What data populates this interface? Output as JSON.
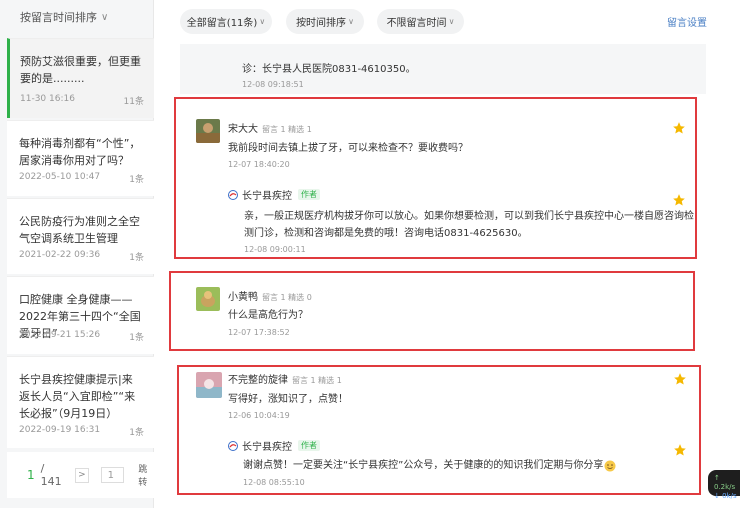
{
  "sidebar": {
    "sort_label": "按留言时间排序",
    "articles": [
      {
        "title": "预防艾滋很重要，但更重要的是.........",
        "date": "11-30 16:16",
        "count": "11条"
      },
      {
        "title": "每种消毒剂都有“个性”，居家消毒你用对了吗？",
        "date": "2022-05-10 10:47",
        "count": "1条"
      },
      {
        "title": "公民防疫行为准则之全空气空调系统卫生管理",
        "date": "2021-02-22 09:36",
        "count": "1条"
      },
      {
        "title": "口腔健康 全身健康——2022年第三十四个“全国爱牙日”",
        "date": "2022-09-21 15:26",
        "count": "1条"
      },
      {
        "title": "长宁县疾控健康提示|来返长人员“入宜即检”“来长必报”（9月19日）",
        "date": "2022-09-19 16:31",
        "count": "1条"
      }
    ],
    "pager": {
      "current": "1",
      "total": "/ 141",
      "next": ">",
      "input": "1",
      "jump": "跳转"
    }
  },
  "filters": {
    "all": "全部留言(11条)",
    "sort": "按时间排序",
    "time": "不限留言时间",
    "settings": "留言设置"
  },
  "prev_tail": {
    "text": "诊：长宁县人民医院0831-4610350。",
    "time": "12-08 09:18:51"
  },
  "comments": [
    {
      "name": "宋大大",
      "stats": "留言 1  精选 1",
      "content": "我前段时间去镇上拔了牙，可以来检查不？要收费吗？",
      "time": "12-07 18:40:20",
      "reply": {
        "name": "长宁县疾控",
        "tag": "作者",
        "content_line1": "亲，一般正规医疗机构拔牙你可以放心。如果你想要检测，可以到我们长宁县疾控中心一楼自愿咨询检",
        "content_line2": "测门诊，检测和咨询都是免费的哦！咨询电话0831-4625630。",
        "time": "12-08 09:00:11"
      }
    },
    {
      "name": "小黄鸭",
      "stats": "留言 1  精选 0",
      "content": "什么是高危行为？",
      "time": "12-07 17:38:52"
    },
    {
      "name": "不完整的旋律",
      "stats": "留言 1  精选 1",
      "content": "写得好，涨知识了，点赞！",
      "time": "12-06 10:04:19",
      "reply": {
        "name": "长宁县疾控",
        "tag": "作者",
        "content_line1": "谢谢点赞！一定要关注“长宁县疾控”公众号，关于健康的的知识我们定期与你分享",
        "time": "12-08 08:55:10"
      }
    }
  ],
  "speed": {
    "up": "↑ 0.2k/s",
    "down": "↓ 0k/s"
  },
  "colors": {
    "accent": "#2fb14a",
    "highlight_border": "#e03a3e",
    "star": "#f5b800",
    "link": "#4a7fc4"
  }
}
